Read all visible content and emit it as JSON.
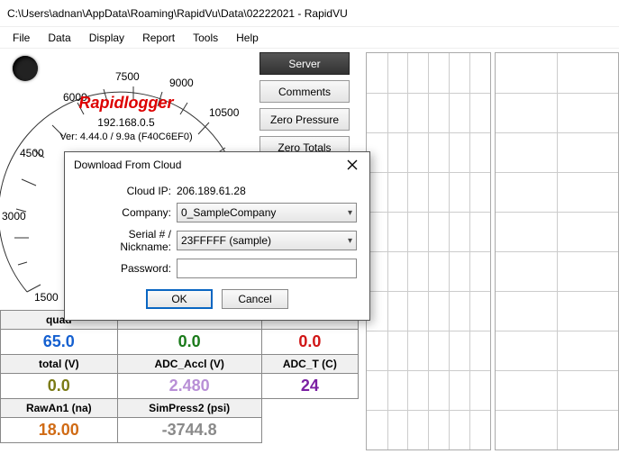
{
  "window": {
    "title": "C:\\Users\\adnan\\AppData\\Roaming\\RapidVu\\Data\\02222021 - RapidVU"
  },
  "menu": {
    "file": "File",
    "data": "Data",
    "display": "Display",
    "report": "Report",
    "tools": "Tools",
    "help": "Help"
  },
  "gauge": {
    "title": "Rapidlogger",
    "ip": "192.168.0.5",
    "ver": "Ver: 4.44.0 / 9.9a (F40C6EF0)",
    "ticks": [
      "1500",
      "3000",
      "4500",
      "6000",
      "7500",
      "9000",
      "10500"
    ]
  },
  "buttons": {
    "server": "Server",
    "comments": "Comments",
    "zero_pressure": "Zero Pressure",
    "zero_totals": "Zero Totals"
  },
  "table": {
    "row1h": [
      "quad",
      "",
      ""
    ],
    "row1v": {
      "a": "65.0",
      "b": "0.0",
      "c": "0.0"
    },
    "row2h": [
      "total (V)",
      "ADC_Accl (V)",
      "ADC_T (C)"
    ],
    "row2v": {
      "a": "0.0",
      "b": "2.480",
      "c": "24"
    },
    "row3h": [
      "RawAn1 (na)",
      "SimPress2 (psi)"
    ],
    "row3v": {
      "a": "18.00",
      "b": "-3744.8"
    }
  },
  "colors": {
    "quad_a": "#1560d0",
    "quad_b": "#1a7a1a",
    "quad_c": "#d01515",
    "total_a": "#7a7a15",
    "adc_accl": "#b88fd6",
    "adc_t": "#7a1fa2",
    "rawan1": "#d06b15",
    "simpress2": "#8a8a8a"
  },
  "dialog": {
    "title": "Download From Cloud",
    "cloud_ip_label": "Cloud IP:",
    "cloud_ip": "206.189.61.28",
    "company_label": "Company:",
    "company": "0_SampleCompany",
    "serial_label": "Serial # / Nickname:",
    "serial": "23FFFFF (sample)",
    "password_label": "Password:",
    "password": "",
    "ok": "OK",
    "cancel": "Cancel"
  }
}
